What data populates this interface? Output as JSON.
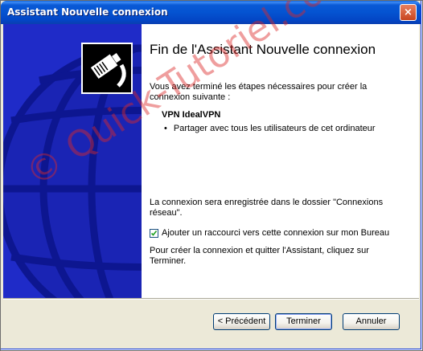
{
  "window": {
    "title": "Assistant Nouvelle connexion",
    "close_glyph": "×"
  },
  "side_panel": {
    "icon": "network-cable-icon",
    "background": "globe-graphic"
  },
  "content": {
    "heading": "Fin de l'Assistant Nouvelle connexion",
    "intro": "Vous avez terminé les étapes nécessaires pour créer la connexion suivante :",
    "connection_name": "VPN IdealVPN",
    "bullet": "Partager avec tous les utilisateurs de cet ordinateur",
    "saved_note": "La connexion sera enregistrée dans le dossier \"Connexions réseau\".",
    "shortcut_checkbox": {
      "label": "Ajouter un raccourci vers cette connexion sur mon Bureau",
      "checked": true
    },
    "finish_note": "Pour créer la connexion et quitter l'Assistant, cliquez sur Terminer."
  },
  "buttons": {
    "previous": "< Précédent",
    "finish": "Terminer",
    "cancel": "Annuler"
  },
  "watermark": "© Quick-Tutoriel.com",
  "colors": {
    "titlebar": "#0453d1",
    "side_panel": "#1f2bc8",
    "watermark": "#dc2828"
  }
}
